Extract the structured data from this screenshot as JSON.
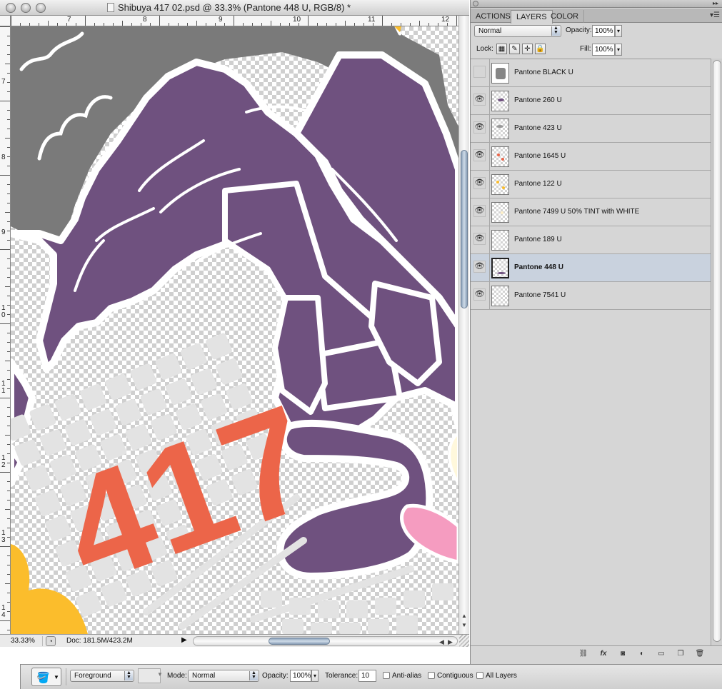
{
  "document": {
    "title": "Shibuya 417 02.psd @ 33.3% (Pantone 448 U, RGB/8) *",
    "ruler_top_numbers": [
      "7",
      "8",
      "9",
      "10",
      "11",
      "12"
    ],
    "ruler_left_numbers": [
      "7",
      "8",
      "9",
      "1 0",
      "1 1",
      "1 2",
      "1 3",
      "1 4"
    ],
    "canvas_text": "417",
    "colors": {
      "purple": "#6f517f",
      "gray": "#7a7a7a",
      "white_outline": "#ffffff",
      "light_gray_grid": "#e3e3e3",
      "orange_red": "#ec6549",
      "yellow": "#fbbd2c",
      "pink": "#f59cc0",
      "cream": "#fff8dc"
    },
    "status": {
      "zoom": "33.33%",
      "doc_size": "Doc: 181.5M/423.2M"
    }
  },
  "panel": {
    "tabs": [
      "ACTIONS",
      "LAYERS",
      "COLOR"
    ],
    "active_tab": "LAYERS",
    "blend_mode": "Normal",
    "opacity_label": "Opacity:",
    "opacity_value": "100%",
    "lock_label": "Lock:",
    "fill_label": "Fill:",
    "fill_value": "100%",
    "layers": [
      {
        "name": "Pantone BLACK U",
        "visible": false,
        "selected": false
      },
      {
        "name": "Pantone 260 U",
        "visible": true,
        "selected": false
      },
      {
        "name": "Pantone 423 U",
        "visible": true,
        "selected": false
      },
      {
        "name": "Pantone 1645 U",
        "visible": true,
        "selected": false
      },
      {
        "name": "Pantone 122 U",
        "visible": true,
        "selected": false
      },
      {
        "name": "Pantone 7499 U 50% TINT with WHITE",
        "visible": true,
        "selected": false
      },
      {
        "name": "Pantone 189 U",
        "visible": true,
        "selected": false
      },
      {
        "name": "Pantone 448 U",
        "visible": true,
        "selected": true
      },
      {
        "name": "Pantone 7541 U",
        "visible": true,
        "selected": false
      }
    ],
    "footer_icons": [
      "link-icon",
      "fx-icon",
      "layer-mask-icon",
      "adjustment-layer-icon",
      "group-folder-icon",
      "new-layer-icon",
      "trash-icon"
    ]
  },
  "options_bar": {
    "fill_source": "Foreground",
    "mode_label": "Mode:",
    "mode_value": "Normal",
    "opacity_label": "Opacity:",
    "opacity_value": "100%",
    "tolerance_label": "Tolerance:",
    "tolerance_value": "10",
    "anti_alias_label": "Anti-alias",
    "contiguous_label": "Contiguous",
    "all_layers_label": "All Layers"
  }
}
